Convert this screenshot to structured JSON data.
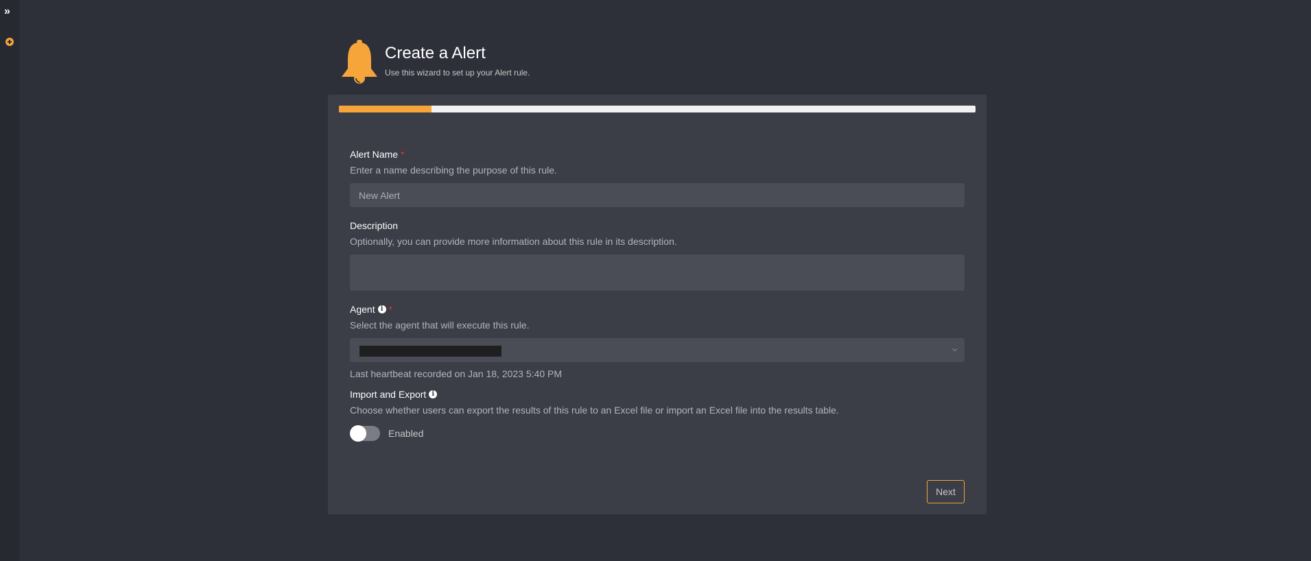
{
  "sidebar": {
    "expand_icon": "double-chevron-right-icon",
    "add_icon": "plus-circle-icon"
  },
  "header": {
    "icon": "bell-icon",
    "title": "Create a Alert",
    "subtitle": "Use this wizard to set up your Alert rule."
  },
  "progress": {
    "fraction": 0.145,
    "fill_color": "#f5a53a"
  },
  "form": {
    "alert_name": {
      "label": "Alert Name",
      "required_mark": "*",
      "help": "Enter a name describing the purpose of this rule.",
      "placeholder": "New Alert",
      "value": ""
    },
    "description": {
      "label": "Description",
      "help": "Optionally, you can provide more information about this rule in its description.",
      "value": ""
    },
    "agent": {
      "label": "Agent",
      "required_mark": "*",
      "info_icon": "info-circle-icon",
      "help": "Select the agent that will execute this rule.",
      "selected_value_redacted": true,
      "heartbeat_note": "Last heartbeat recorded on Jan 18, 2023 5:40 PM"
    },
    "import_export": {
      "label": "Import and Export",
      "info_icon": "info-circle-icon",
      "help": "Choose whether users can export the results of this rule to an Excel file or import an Excel file into the results table.",
      "toggle_label": "Enabled",
      "toggle_on": false
    }
  },
  "footer": {
    "next_label": "Next"
  },
  "colors": {
    "accent": "#f5a53a",
    "required": "#e0343a",
    "background": "#2e3039",
    "card": "#3b3d47"
  }
}
